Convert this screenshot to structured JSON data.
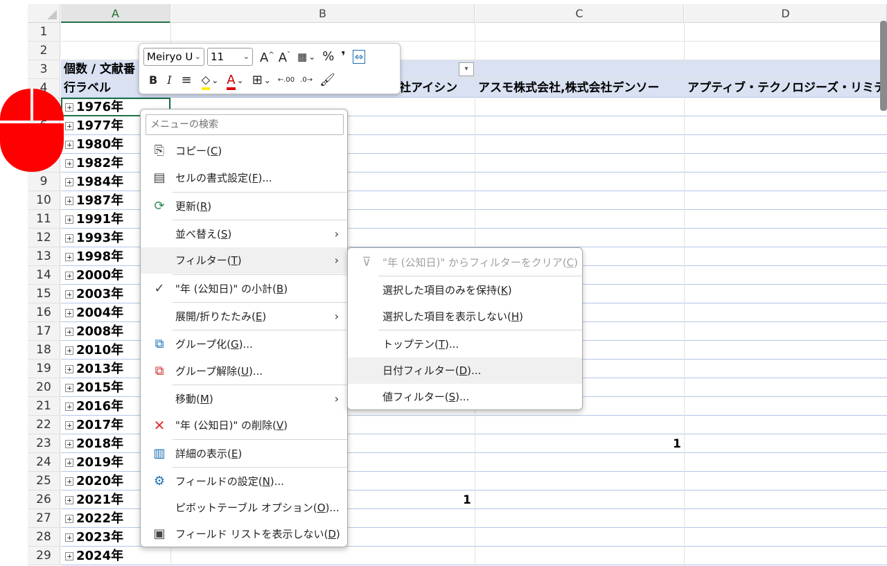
{
  "columns": [
    "A",
    "B",
    "C",
    "D"
  ],
  "rows": [
    "1",
    "2",
    "3",
    "4",
    "5",
    "6",
    "7",
    "8",
    "9",
    "10",
    "11",
    "12",
    "13",
    "14",
    "15",
    "16",
    "17",
    "18",
    "19",
    "20",
    "21",
    "22",
    "23",
    "24",
    "25",
    "26",
    "27",
    "28",
    "29"
  ],
  "pivot": {
    "row3_label": "個数 / 文献番",
    "row4_label": "行ラベル",
    "header_b_fragment": "社アイシン",
    "header_c": "アスモ株式会社,株式会社デンソー",
    "header_d": "アプティブ・テクノロジーズ・リミテッ",
    "years": [
      "1976年",
      "1977年",
      "1980年",
      "1982年",
      "1984年",
      "1987年",
      "1991年",
      "1993年",
      "1998年",
      "2000年",
      "2003年",
      "2004年",
      "2008年",
      "2010年",
      "2013年",
      "2015年",
      "2016年",
      "2017年",
      "2018年",
      "2019年",
      "2020年",
      "2021年",
      "2022年",
      "2023年",
      "2024年"
    ],
    "value_row23_colC": "1",
    "value_row26_colB": "1"
  },
  "mini_toolbar": {
    "font_name": "Meiryo U",
    "font_size": "11",
    "bold": "B",
    "italic": "I",
    "percent": "%",
    "comma": "❜",
    "grow_font": "A",
    "shrink_font": "A",
    "font_color_letter": "A",
    "dec_inc": ".00",
    "dec_dec": ".0"
  },
  "context_menu": {
    "search_placeholder": "メニューの検索",
    "items": [
      {
        "label": "コピー(",
        "key": "C",
        "end": ")",
        "icon": "copy-icon"
      },
      {
        "label": "セルの書式設定(",
        "key": "F",
        "end": ")...",
        "icon": "format-cells-icon"
      },
      {
        "label": "更新(",
        "key": "R",
        "end": ")",
        "icon": "refresh-icon"
      },
      {
        "label": "並べ替え(",
        "key": "S",
        "end": ")"
      },
      {
        "label": "フィルター(",
        "key": "T",
        "end": ")"
      },
      {
        "label": "\"年 (公知日)\" の小計(",
        "key": "B",
        "end": ")",
        "icon": "check-icon"
      },
      {
        "label": "展開/折りたたみ(",
        "key": "E",
        "end": ")"
      },
      {
        "label": "グループ化(",
        "key": "G",
        "end": ")...",
        "icon": "group-icon"
      },
      {
        "label": "グループ解除(",
        "key": "U",
        "end": ")...",
        "icon": "ungroup-icon"
      },
      {
        "label": "移動(",
        "key": "M",
        "end": ")"
      },
      {
        "label": "\"年 (公知日)\" の削除(",
        "key": "V",
        "end": ")",
        "icon": "delete-x-icon"
      },
      {
        "label": "詳細の表示(",
        "key": "E",
        "end": ")",
        "icon": "show-details-icon"
      },
      {
        "label": "フィールドの設定(",
        "key": "N",
        "end": ")...",
        "icon": "field-settings-icon"
      },
      {
        "label": "ピボットテーブル オプション(",
        "key": "O",
        "end": ")..."
      },
      {
        "label": "フィールド リストを表示しない(",
        "key": "D",
        "end": ")",
        "icon": "field-list-icon"
      }
    ]
  },
  "filter_submenu": {
    "items": [
      {
        "label": "\"年 (公知日)\" からフィルターをクリア(",
        "key": "C",
        "end": ")"
      },
      {
        "label": "選択した項目のみを保持(",
        "key": "K",
        "end": ")"
      },
      {
        "label": "選択した項目を表示しない(",
        "key": "H",
        "end": ")"
      },
      {
        "label": "トップテン(",
        "key": "T",
        "end": ")..."
      },
      {
        "label": "日付フィルター(",
        "key": "D",
        "end": ")..."
      },
      {
        "label": "値フィルター(",
        "key": "S",
        "end": ")..."
      }
    ]
  },
  "colors": {
    "pivot_header_band": "#d9e1f2",
    "selection_border": "#1e7145",
    "cursor_overlay": "#ff0000",
    "delete_icon": "#e03030"
  }
}
